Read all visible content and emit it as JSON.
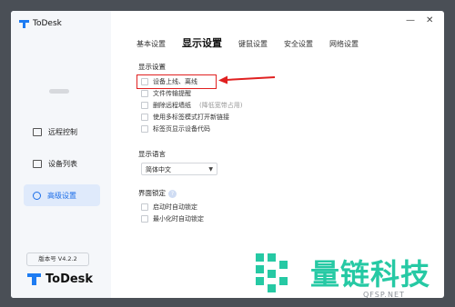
{
  "app": {
    "title": "ToDesk",
    "version": "版本号 V4.2.2",
    "footer_brand": "ToDesk"
  },
  "window_controls": {
    "minimize": "—",
    "close": "✕"
  },
  "sidebar": {
    "items": [
      {
        "label": "远程控制",
        "icon": "monitor-icon"
      },
      {
        "label": "设备列表",
        "icon": "devices-icon"
      },
      {
        "label": "高级设置",
        "icon": "settings-icon",
        "active": true
      }
    ]
  },
  "tabs": [
    {
      "label": "基本设置"
    },
    {
      "label": "显示设置",
      "active": true
    },
    {
      "label": "键鼠设置"
    },
    {
      "label": "安全设置"
    },
    {
      "label": "网络设置"
    }
  ],
  "display_settings": {
    "title": "显示设置",
    "options": [
      {
        "label": "设备上线、离线",
        "checked": false
      },
      {
        "label": "文件传输提醒",
        "checked": false
      },
      {
        "label": "删除远程墙纸",
        "hint": "(降低宽带占用)",
        "checked": false
      },
      {
        "label": "使用多标签模式打开新链接",
        "checked": false
      },
      {
        "label": "标签页显示设备代码",
        "checked": false
      }
    ]
  },
  "language": {
    "title": "显示语言",
    "selected": "简体中文"
  },
  "lock": {
    "title": "界面锁定",
    "options": [
      {
        "label": "启动时自动锁定",
        "checked": false
      },
      {
        "label": "最小化时自动锁定",
        "checked": false
      }
    ]
  },
  "watermark": {
    "text": "量链科技",
    "domain": "QFSP.NET"
  },
  "colors": {
    "accent": "#1c6ee8",
    "highlight": "#e02020",
    "watermark": "#26c9a4"
  }
}
